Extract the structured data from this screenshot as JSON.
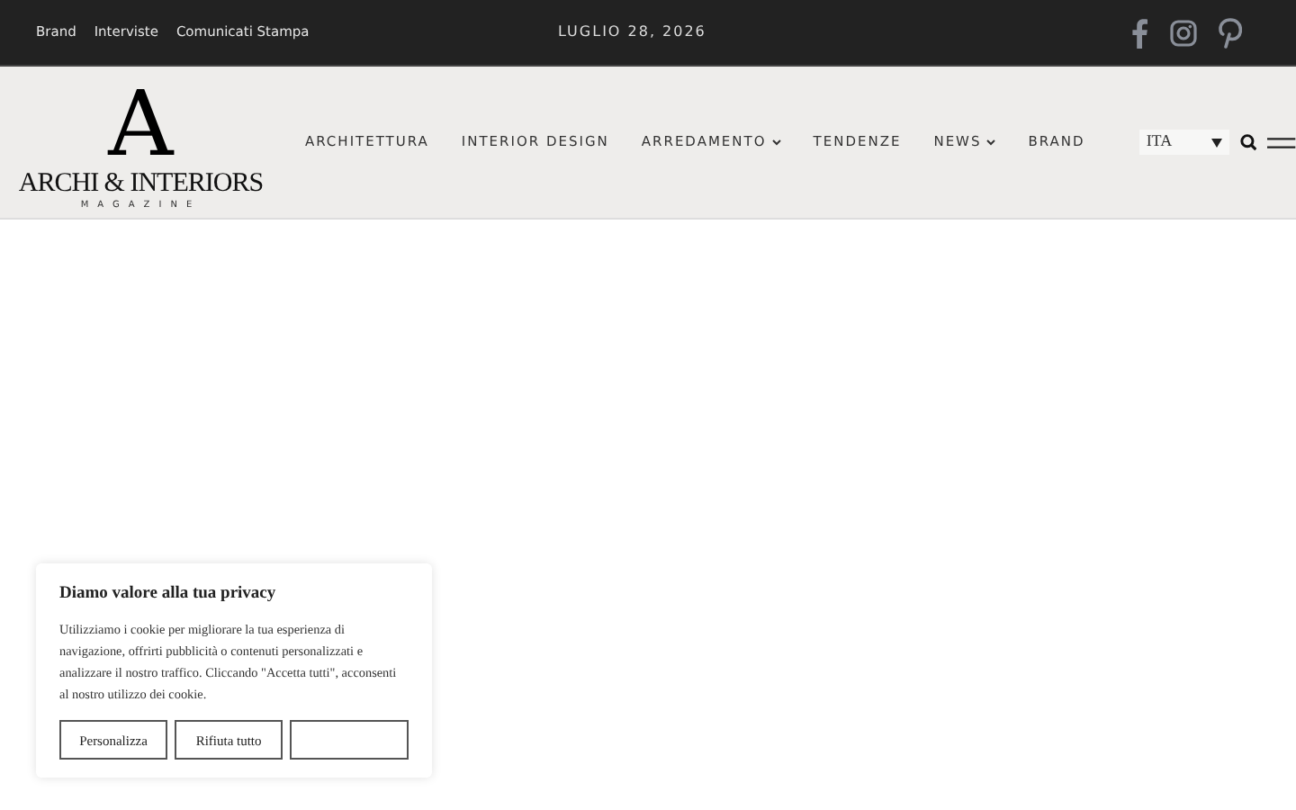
{
  "top_bar": {
    "links": [
      "Brand",
      "Interviste",
      "Comunicati Stampa"
    ],
    "date": "LUGLIO 28, 2026"
  },
  "logo": {
    "mark": "A",
    "name": "ARCHI & INTERIORS",
    "tagline": "MAGAZINE"
  },
  "nav": [
    {
      "label": "ARCHITETTURA",
      "has_caret": false
    },
    {
      "label": "INTERIOR DESIGN",
      "has_caret": false
    },
    {
      "label": "ARREDAMENTO",
      "has_caret": true
    },
    {
      "label": "TENDENZE",
      "has_caret": false
    },
    {
      "label": "NEWS",
      "has_caret": true
    },
    {
      "label": "BRAND",
      "has_caret": false
    }
  ],
  "language_select": {
    "value": "ITA"
  },
  "cookie_banner": {
    "title": "Diamo valore alla tua privacy",
    "text": "Utilizziamo i cookie per migliorare la tua esperienza di navigazione, offrirti pubblicità o contenuti personalizzati e analizzare il nostro traffico. Cliccando \"Accetta tutti\", acconsenti al nostro utilizzo dei cookie.",
    "buttons": [
      {
        "kind": "text",
        "label": "Personalizza"
      },
      {
        "kind": "text",
        "label": "Rifiuta tutto"
      },
      {
        "kind": "blank"
      }
    ]
  }
}
